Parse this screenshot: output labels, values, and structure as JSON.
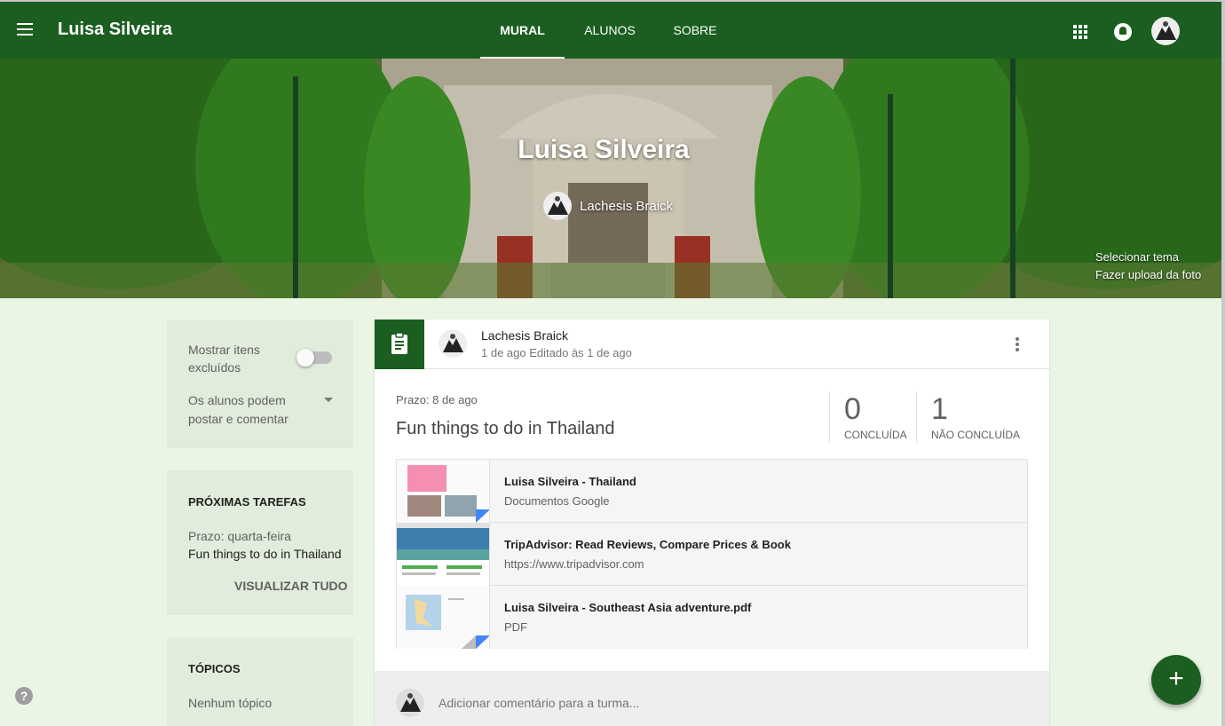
{
  "app": {
    "title": "Luisa Silveira"
  },
  "tabs": [
    {
      "label": "MURAL",
      "active": true
    },
    {
      "label": "ALUNOS",
      "active": false
    },
    {
      "label": "SOBRE",
      "active": false
    }
  ],
  "banner": {
    "title": "Luisa Silveira",
    "teacher": "Lachesis Braick",
    "select_theme": "Selecionar tema",
    "upload_photo": "Fazer upload da foto"
  },
  "settings": {
    "show_deleted_label": "Mostrar itens excluídos",
    "show_deleted_on": false,
    "student_permission": "Os alunos podem postar e comentar"
  },
  "upcoming": {
    "heading": "PRÓXIMAS TAREFAS",
    "due_label": "Prazo: quarta-feira",
    "task": "Fun things to do in Thailand",
    "view_all": "VISUALIZAR TUDO"
  },
  "topics": {
    "heading": "TÓPICOS",
    "empty": "Nenhum tópico"
  },
  "post": {
    "author": "Lachesis Braick",
    "meta": "1 de ago Editado às 1 de ago",
    "due": "Prazo: 8 de ago",
    "title": "Fun things to do in Thailand",
    "done_count": "0",
    "done_label": "CONCLUÍDA",
    "not_done_count": "1",
    "not_done_label": "NÃO CONCLUÍDA",
    "attachments": [
      {
        "title": "Luisa Silveira - Thailand",
        "subtitle": "Documentos Google",
        "icon": "google-docs-thumbnail"
      },
      {
        "title": "TripAdvisor: Read Reviews, Compare Prices & Book",
        "subtitle": "https://www.tripadvisor.com",
        "icon": "website-thumbnail"
      },
      {
        "title": "Luisa Silveira - Southeast Asia adventure.pdf",
        "subtitle": "PDF",
        "icon": "pdf-thumbnail"
      }
    ],
    "comment_placeholder": "Adicionar comentário para a turma..."
  },
  "fab": {
    "label": "+"
  },
  "help": {
    "label": "?"
  },
  "colors": {
    "brand": "#1b5e20",
    "background": "#eaf5e4",
    "card": "#e1ecdc"
  }
}
